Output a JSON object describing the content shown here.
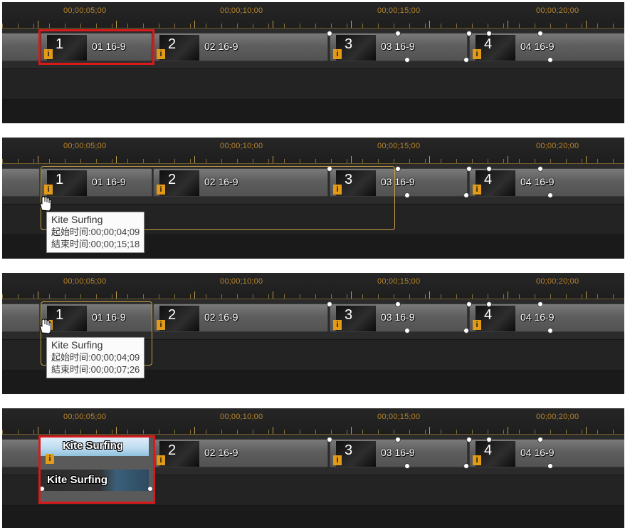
{
  "timecodes": [
    "00;00;05;00",
    "00;00;10;00",
    "00;00;15;00",
    "00;00;20;00"
  ],
  "clips": [
    {
      "num": "1",
      "label": "01 16-9"
    },
    {
      "num": "2",
      "label": "02 16-9"
    },
    {
      "num": "3",
      "label": "03 16-9"
    },
    {
      "num": "4",
      "label": "04 16-9"
    }
  ],
  "info_glyph": "i",
  "tooltip_a": {
    "title": "Kite Surfing",
    "start": "起始时间:00;00;04;09",
    "end": "結束时间:00;00;15;18"
  },
  "tooltip_b": {
    "title": "Kite Surfing",
    "start": "起始时间:00;00;04;09",
    "end": "結束时间:00;00;07;26"
  },
  "replaced_clip": {
    "video_label": "Kite Surfing",
    "audio_label": "Kite Surfing"
  },
  "colors": {
    "selection_red": "#d81a1a",
    "selection_yellow": "#c9a045",
    "timecode": "#b8842a",
    "info_badge": "#e39a16"
  },
  "icons": [
    "hand-cursor-icon",
    "info-icon",
    "handle-dot-icon"
  ]
}
